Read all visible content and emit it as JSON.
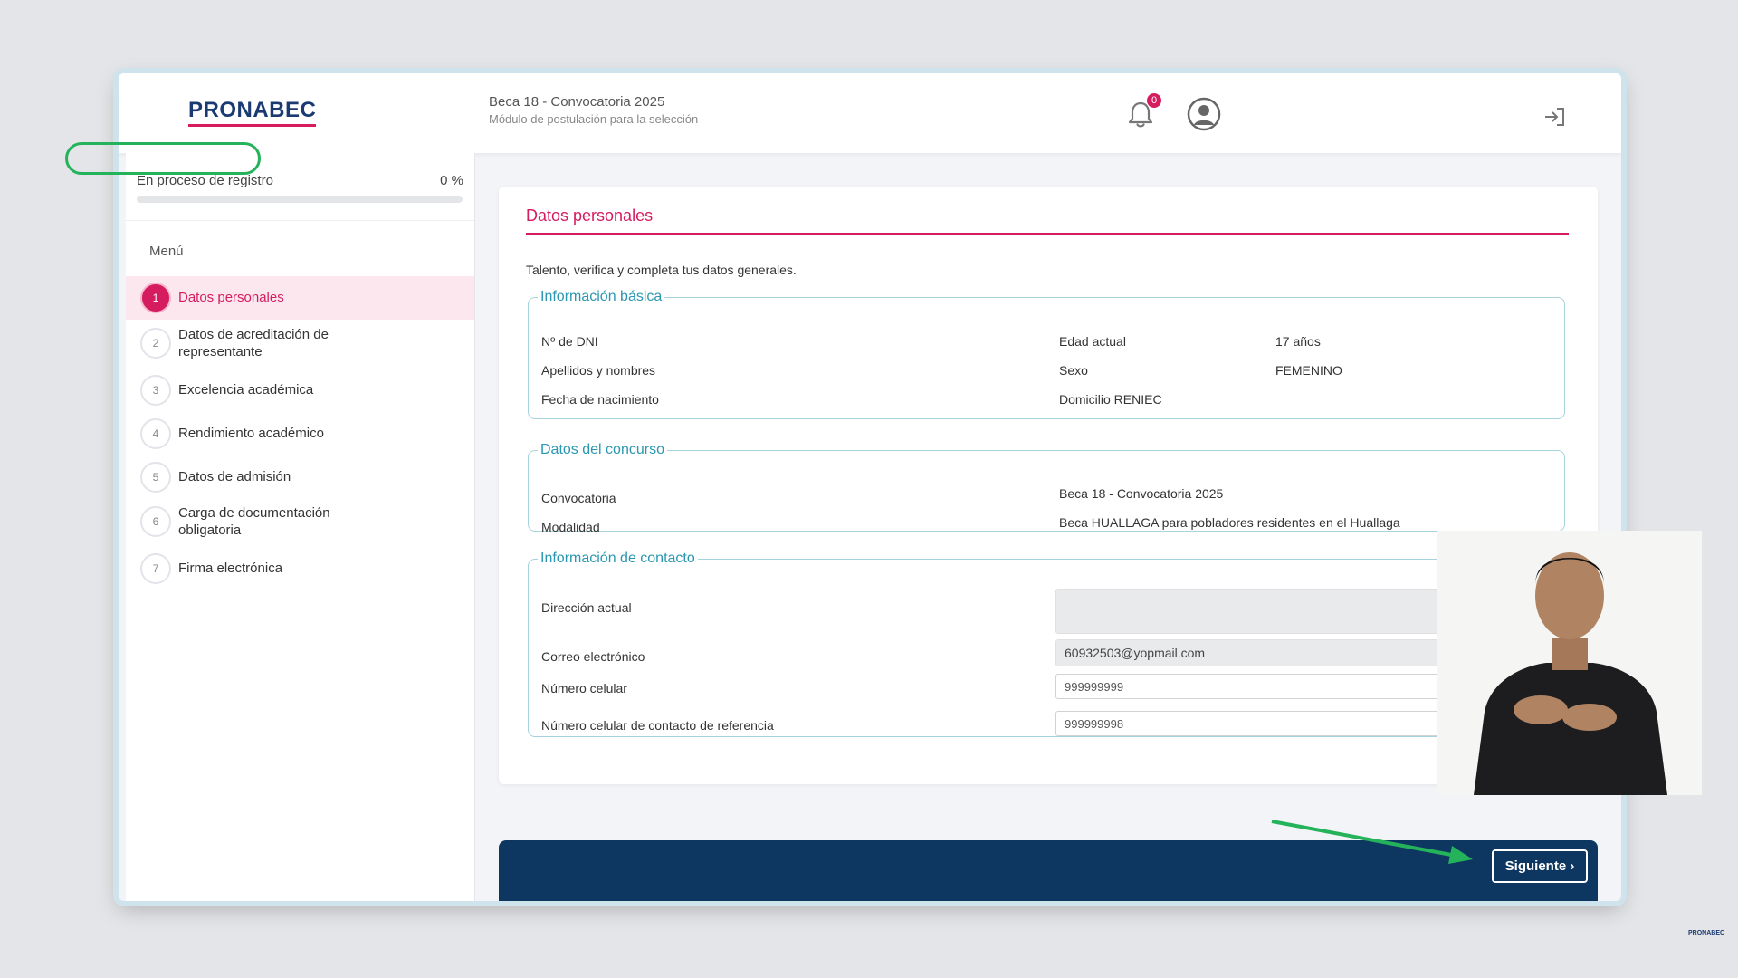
{
  "header": {
    "logo": "PRONABEC",
    "title": "Beca 18 - Convocatoria 2025",
    "subtitle": "Módulo de postulación para la selección",
    "notifications_count": "0"
  },
  "sidebar": {
    "progress_label": "En proceso de registro",
    "progress_percent_text": "0 %",
    "progress_fraction": 0,
    "menu_title": "Menú",
    "items": [
      {
        "num": "1",
        "label": "Datos personales",
        "active": true
      },
      {
        "num": "2",
        "label": "Datos de acreditación de representante"
      },
      {
        "num": "3",
        "label": "Excelencia académica"
      },
      {
        "num": "4",
        "label": "Rendimiento académico"
      },
      {
        "num": "5",
        "label": "Datos de admisión"
      },
      {
        "num": "6",
        "label": "Carga de documentación obligatoria"
      },
      {
        "num": "7",
        "label": "Firma electrónica"
      }
    ]
  },
  "main": {
    "section_title": "Datos personales",
    "intro": "Talento, verifica y completa tus datos generales.",
    "basic_info": {
      "legend": "Información básica",
      "dni_label": "Nº de DNI",
      "names_label": "Apellidos y nombres",
      "birth_label": "Fecha de nacimiento",
      "age_label": "Edad actual",
      "age_value": "17 años",
      "sex_label": "Sexo",
      "sex_value": "FEMENINO",
      "address_label": "Domicilio RENIEC"
    },
    "contest": {
      "legend": "Datos del concurso",
      "call_label": "Convocatoria",
      "call_value": "Beca 18 - Convocatoria 2025",
      "modality_label": "Modalidad",
      "modality_value": "Beca HUALLAGA para pobladores residentes en el Huallaga"
    },
    "contact": {
      "legend": "Información de contacto",
      "address_label": "Dirección actual",
      "address_value": "",
      "email_label": "Correo electrónico",
      "email_value": "60932503@yopmail.com",
      "phone_label": "Número celular",
      "phone_value": "999999999",
      "ref_phone_label": "Número celular de contacto de referencia",
      "ref_phone_value": "999999998"
    }
  },
  "footer": {
    "next_label": "Siguiente ›"
  },
  "watermark": "PRONABEC",
  "colors": {
    "accent": "#d51c5f",
    "section_border": "#a6d3de",
    "legend": "#2b97b1",
    "footer_bar": "#0d3660",
    "annotation": "#24b35a"
  }
}
